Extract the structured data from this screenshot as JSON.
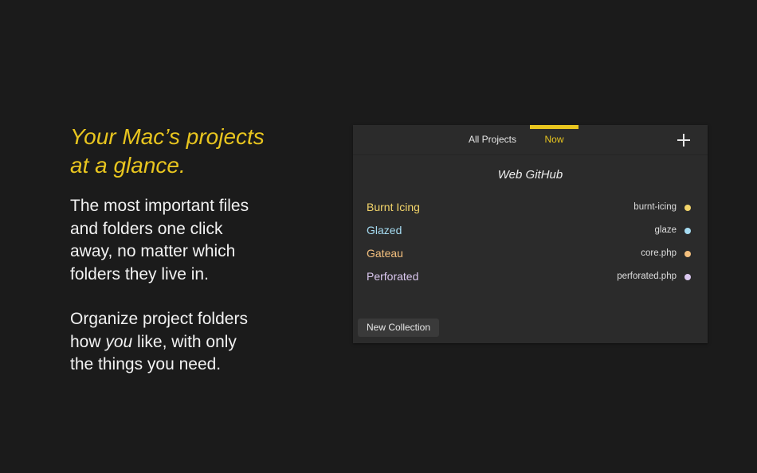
{
  "hero": {
    "headline_line1": "Your Mac’s projects",
    "headline_line2": "at a glance.",
    "paragraph1_line1": "The most important files",
    "paragraph1_line2": "and folders one click",
    "paragraph1_line3": "away, no matter which",
    "paragraph1_line4": "folders they live in.",
    "paragraph2_line1": "Organize project folders",
    "paragraph2_line2_before": "how ",
    "paragraph2_line2_emphasis": "you",
    "paragraph2_line2_after": " like, with only",
    "paragraph2_line3": "the things you need."
  },
  "panel": {
    "tabs": {
      "all_projects": "All Projects",
      "now": "Now"
    },
    "active_tab": "now",
    "add_icon": "plus-icon",
    "collection_title": "Web GitHub",
    "items": [
      {
        "name": "Burnt Icing",
        "file": "burnt-icing",
        "color": "#f3d56a"
      },
      {
        "name": "Glazed",
        "file": "glaze",
        "color": "#a6dcf2"
      },
      {
        "name": "Gateau",
        "file": "core.php",
        "color": "#f4c07e"
      },
      {
        "name": "Perforated",
        "file": "perforated.php",
        "color": "#dbc8f0"
      }
    ],
    "new_collection_label": "New Collection"
  },
  "colors": {
    "background": "#1b1b1b",
    "panel": "#2b2b2b",
    "accent": "#e8c51f"
  }
}
